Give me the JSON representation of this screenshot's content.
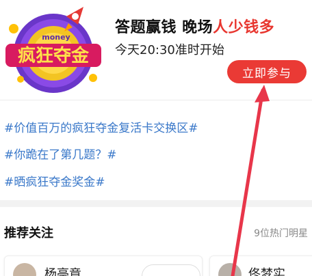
{
  "promo": {
    "logo_text": "疯狂夺金",
    "logo_sub": "money",
    "title_main": "答题赢钱 晚场",
    "title_highlight": "人少钱多",
    "subtitle": "今天20:30准时开始",
    "join_label": "立即参与"
  },
  "topics": [
    "#价值百万的疯狂夺金复活卡交换区#",
    "#你跪在了第几题？#",
    "#晒疯狂夺金奖金#"
  ],
  "recommended": {
    "title": "推荐关注",
    "count": "9位热门明星",
    "cards": [
      {
        "name": "杨亭竟"
      },
      {
        "name": "佟梦实"
      }
    ]
  },
  "colors": {
    "accent": "#ea3a35",
    "topic": "#3a78c9",
    "annotation": "#e8364a"
  }
}
